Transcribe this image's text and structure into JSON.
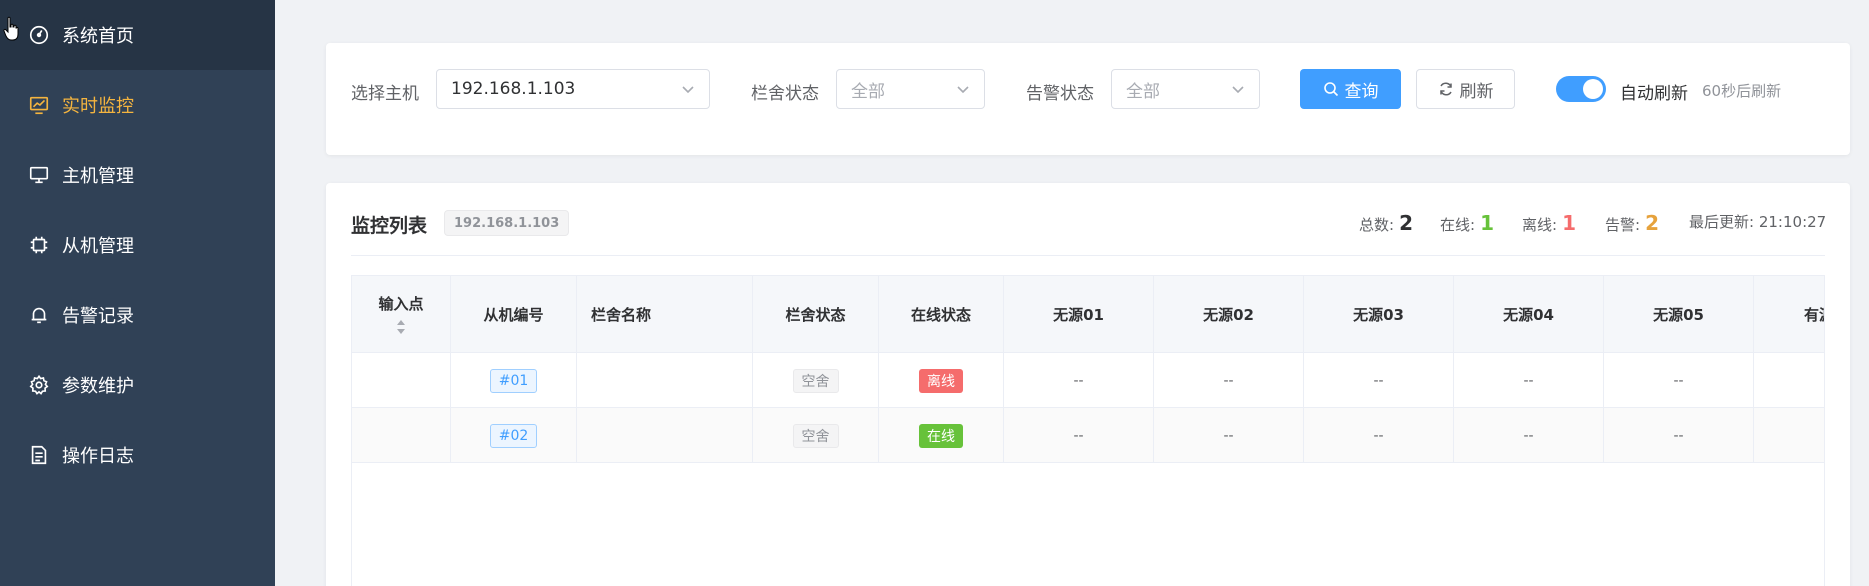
{
  "sidebar": {
    "items": [
      {
        "label": "系统首页",
        "icon": "dashboard-icon"
      },
      {
        "label": "实时监控",
        "icon": "monitor-chart-icon"
      },
      {
        "label": "主机管理",
        "icon": "desktop-icon"
      },
      {
        "label": "从机管理",
        "icon": "cpu-icon"
      },
      {
        "label": "告警记录",
        "icon": "bell-icon"
      },
      {
        "label": "参数维护",
        "icon": "gear-icon"
      },
      {
        "label": "操作日志",
        "icon": "document-icon"
      }
    ],
    "active_index": 1
  },
  "filter": {
    "host_label": "选择主机",
    "host_value": "192.168.1.103",
    "pen_status_label": "栏舍状态",
    "pen_status_value": "全部",
    "alarm_status_label": "告警状态",
    "alarm_status_value": "全部",
    "query_label": "查询",
    "refresh_label": "刷新",
    "auto_refresh_label": "自动刷新",
    "auto_refresh_on": true,
    "auto_refresh_hint": "60秒后刷新"
  },
  "list": {
    "title": "监控列表",
    "host_tag": "192.168.1.103",
    "stats": {
      "total_label": "总数:",
      "total": "2",
      "online_label": "在线:",
      "online": "1",
      "offline_label": "离线:",
      "offline": "1",
      "alarm_label": "告警:",
      "alarm": "2",
      "updated_label": "最后更新:",
      "updated": "21:10:27"
    }
  },
  "table": {
    "headers": [
      "输入点",
      "从机编号",
      "栏舍名称",
      "栏舍状态",
      "在线状态",
      "无源01",
      "无源02",
      "无源03",
      "无源04",
      "无源05",
      "有源"
    ],
    "rows": [
      {
        "input": "",
        "slave_id": "#01",
        "pen_name": "",
        "pen_status": "空舍",
        "online_status": "离线",
        "online_color": "#f56c6c",
        "p1": "--",
        "p2": "--",
        "p3": "--",
        "p4": "--",
        "p5": "--",
        "a1": "-"
      },
      {
        "input": "",
        "slave_id": "#02",
        "pen_name": "",
        "pen_status": "空舍",
        "online_status": "在线",
        "online_color": "#67c23a",
        "p1": "--",
        "p2": "--",
        "p3": "--",
        "p4": "--",
        "p5": "--",
        "a1": "-"
      }
    ]
  },
  "colors": {
    "sidebar_bg": "#304156",
    "active_menu": "#f4b43f",
    "primary": "#409eff",
    "online": "#67c23a",
    "offline": "#f56c6c",
    "alarm": "#e6a23c"
  }
}
